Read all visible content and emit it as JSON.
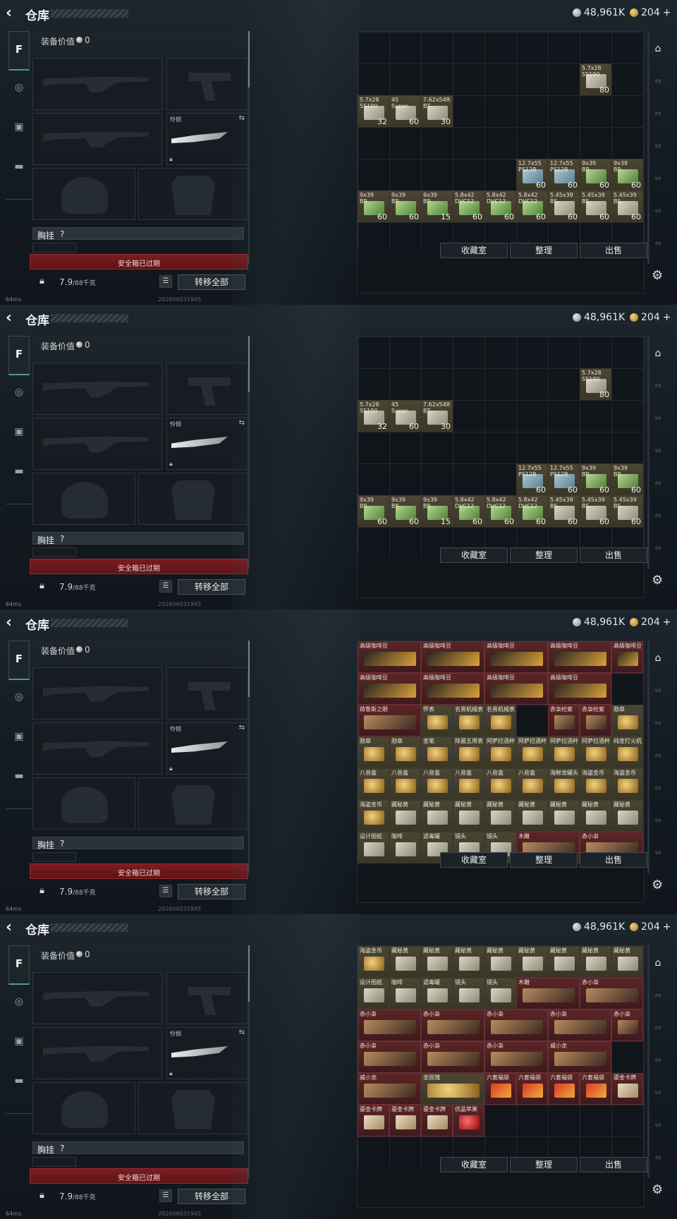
{
  "header": {
    "back_icon": "chevron-left-icon",
    "title": "仓库",
    "silver": "48,961K",
    "gold": "204",
    "plus": "+"
  },
  "left_nav": [
    "weapon-tab",
    "armor-tab",
    "backpack-tab",
    "case-tab"
  ],
  "equipment": {
    "value_label": "装备价值",
    "value": "0",
    "knife_label": "怜悯",
    "vest_label": "胸挂",
    "vest_q": "?",
    "safe_label": "安全箱已过期",
    "weight": "7.9",
    "weight_unit": "/88千克",
    "move_all": "转移全部"
  },
  "status": {
    "ping": "64ms",
    "build": "202606031945"
  },
  "bottom_buttons": {
    "collect": "收藏室",
    "sort": "整理",
    "sell": "出售"
  },
  "frames": [
    {
      "items": [
        {
          "l": "5.7x28\nSS190",
          "c": "80",
          "col": 7,
          "row": 1,
          "t": "ammo"
        },
        {
          "l": "5.7x28\nSS190",
          "c": "32",
          "col": 0,
          "row": 2,
          "t": "ammo"
        },
        {
          "l": "45\nSuper",
          "c": "60",
          "col": 1,
          "row": 2,
          "t": "ammo"
        },
        {
          "l": "7.62x54R\nBT",
          "c": "30",
          "col": 2,
          "row": 2,
          "t": "ammo"
        },
        {
          "l": "12.7x55\nPS12B",
          "c": "60",
          "col": 5,
          "row": 4,
          "t": "blue"
        },
        {
          "l": "12.7x55\nPS12B",
          "c": "60",
          "col": 6,
          "row": 4,
          "t": "blue"
        },
        {
          "l": "9x39\nBP",
          "c": "60",
          "col": 7,
          "row": 4,
          "t": "green"
        },
        {
          "l": "9x39\nBP",
          "c": "60",
          "col": 8,
          "row": 4,
          "t": "green"
        },
        {
          "l": "9x39\nBP",
          "c": "60",
          "col": 0,
          "row": 5,
          "t": "green"
        },
        {
          "l": "9x39\nBP",
          "c": "60",
          "col": 1,
          "row": 5,
          "t": "green"
        },
        {
          "l": "9x39\nBP",
          "c": "15",
          "col": 2,
          "row": 5,
          "t": "green"
        },
        {
          "l": "5.8x42\nDVC12",
          "c": "60",
          "col": 3,
          "row": 5,
          "t": "green"
        },
        {
          "l": "5.8x42\nDVC12",
          "c": "60",
          "col": 4,
          "row": 5,
          "t": "green"
        },
        {
          "l": "5.8x42\nDVC12",
          "c": "60",
          "col": 5,
          "row": 5,
          "t": "green"
        },
        {
          "l": "5.45x39\nBS",
          "c": "60",
          "col": 6,
          "row": 5,
          "t": "ammo"
        },
        {
          "l": "5.45x39\nBS",
          "c": "60",
          "col": 7,
          "row": 5,
          "t": "ammo"
        },
        {
          "l": "5.45x39\nBS",
          "c": "60",
          "col": 8,
          "row": 5,
          "t": "ammo"
        }
      ]
    },
    {
      "items": [
        {
          "l": "5.7x28\nSS190",
          "c": "80",
          "col": 7,
          "row": 1,
          "t": "ammo"
        },
        {
          "l": "5.7x28\nSS190",
          "c": "32",
          "col": 0,
          "row": 2,
          "t": "ammo"
        },
        {
          "l": "45\nSuper",
          "c": "60",
          "col": 1,
          "row": 2,
          "t": "ammo"
        },
        {
          "l": "7.62x54R\nBT",
          "c": "30",
          "col": 2,
          "row": 2,
          "t": "ammo"
        },
        {
          "l": "12.7x55\nPS12B",
          "c": "60",
          "col": 5,
          "row": 4,
          "t": "blue"
        },
        {
          "l": "12.7x55\nPS12B",
          "c": "60",
          "col": 6,
          "row": 4,
          "t": "blue"
        },
        {
          "l": "9x39\nBP",
          "c": "60",
          "col": 7,
          "row": 4,
          "t": "green"
        },
        {
          "l": "9x39\nBP",
          "c": "60",
          "col": 8,
          "row": 4,
          "t": "green"
        },
        {
          "l": "9x39\nBP",
          "c": "60",
          "col": 0,
          "row": 5,
          "t": "green"
        },
        {
          "l": "9x39\nBP",
          "c": "60",
          "col": 1,
          "row": 5,
          "t": "green"
        },
        {
          "l": "9x39\nBP",
          "c": "15",
          "col": 2,
          "row": 5,
          "t": "green"
        },
        {
          "l": "5.8x42\nDVC12",
          "c": "60",
          "col": 3,
          "row": 5,
          "t": "green"
        },
        {
          "l": "5.8x42\nDVC12",
          "c": "60",
          "col": 4,
          "row": 5,
          "t": "green"
        },
        {
          "l": "5.8x42\nDVC12",
          "c": "60",
          "col": 5,
          "row": 5,
          "t": "green"
        },
        {
          "l": "5.45x39\nBS",
          "c": "60",
          "col": 6,
          "row": 5,
          "t": "ammo"
        },
        {
          "l": "5.45x39\nBS",
          "c": "60",
          "col": 7,
          "row": 5,
          "t": "ammo"
        },
        {
          "l": "5.45x39\nBS",
          "c": "60",
          "col": 8,
          "row": 5,
          "t": "ammo"
        }
      ]
    },
    {
      "items": [
        {
          "l": "高级咖啡豆",
          "col": 0,
          "row": 0,
          "w": 2,
          "t": "coffee"
        },
        {
          "l": "高级咖啡豆",
          "col": 2,
          "row": 0,
          "w": 2,
          "t": "coffee"
        },
        {
          "l": "高级咖啡豆",
          "col": 4,
          "row": 0,
          "w": 2,
          "t": "coffee"
        },
        {
          "l": "高级咖啡豆",
          "col": 6,
          "row": 0,
          "w": 2,
          "t": "coffee"
        },
        {
          "l": "高级咖啡豆",
          "col": 8,
          "row": 0,
          "t": "coffee"
        },
        {
          "l": "高级咖啡豆",
          "col": 0,
          "row": 1,
          "w": 2,
          "t": "coffee"
        },
        {
          "l": "高级咖啡豆",
          "col": 2,
          "row": 1,
          "w": 2,
          "t": "coffee"
        },
        {
          "l": "高级咖啡豆",
          "col": 4,
          "row": 1,
          "w": 2,
          "t": "coffee"
        },
        {
          "l": "高级咖啡豆",
          "col": 6,
          "row": 1,
          "w": 2,
          "t": "coffee"
        },
        {
          "l": "荷鲁斯之眼",
          "col": 0,
          "row": 2,
          "w": 2,
          "t": "statue"
        },
        {
          "l": "怀表",
          "col": 2,
          "row": 2,
          "t": "gold"
        },
        {
          "l": "名贵机械表",
          "col": 3,
          "row": 2,
          "t": "gold"
        },
        {
          "l": "名贵机械表",
          "col": 4,
          "row": 2,
          "t": "gold"
        },
        {
          "l": "赤枭检索",
          "col": 6,
          "row": 2,
          "t": "statue"
        },
        {
          "l": "赤枭检索",
          "col": 7,
          "row": 2,
          "t": "statue"
        },
        {
          "l": "勋章",
          "col": 8,
          "row": 2,
          "t": "gold"
        },
        {
          "l": "勋章",
          "col": 0,
          "row": 3,
          "t": "gold"
        },
        {
          "l": "勋章",
          "col": 1,
          "row": 3,
          "t": "gold"
        },
        {
          "l": "金笔",
          "col": 2,
          "row": 3,
          "t": "gold"
        },
        {
          "l": "除菌五用表",
          "col": 3,
          "row": 3,
          "t": "gold"
        },
        {
          "l": "阿萨拉酒杯",
          "col": 4,
          "row": 3,
          "t": "gold"
        },
        {
          "l": "阿萨拉酒杯",
          "col": 5,
          "row": 3,
          "t": "gold"
        },
        {
          "l": "阿萨拉酒杯",
          "col": 6,
          "row": 3,
          "t": "gold"
        },
        {
          "l": "阿萨拉酒杯",
          "col": 7,
          "row": 3,
          "t": "gold"
        },
        {
          "l": "纯金打火机",
          "col": 8,
          "row": 3,
          "t": "gold"
        },
        {
          "l": "八音盒",
          "col": 0,
          "row": 4,
          "t": "gold"
        },
        {
          "l": "八音盒",
          "col": 1,
          "row": 4,
          "t": "gold"
        },
        {
          "l": "八音盒",
          "col": 2,
          "row": 4,
          "t": "gold"
        },
        {
          "l": "八音盒",
          "col": 3,
          "row": 4,
          "t": "gold"
        },
        {
          "l": "八音盒",
          "col": 4,
          "row": 4,
          "t": "gold"
        },
        {
          "l": "八音盒",
          "col": 5,
          "row": 4,
          "t": "gold"
        },
        {
          "l": "海鲜龙罐头",
          "col": 6,
          "row": 4,
          "t": "gold"
        },
        {
          "l": "海盗金币",
          "col": 7,
          "row": 4,
          "t": "gold"
        },
        {
          "l": "海盗金币",
          "col": 8,
          "row": 4,
          "t": "gold"
        },
        {
          "l": "海盗金币",
          "col": 0,
          "row": 5,
          "t": "gold"
        },
        {
          "l": "藏秘黄",
          "col": 1,
          "row": 5,
          "t": "ammo"
        },
        {
          "l": "藏秘黄",
          "col": 2,
          "row": 5,
          "t": "ammo"
        },
        {
          "l": "藏秘黄",
          "col": 3,
          "row": 5,
          "t": "ammo"
        },
        {
          "l": "藏秘黄",
          "col": 4,
          "row": 5,
          "t": "ammo"
        },
        {
          "l": "藏秘黄",
          "col": 5,
          "row": 5,
          "t": "ammo"
        },
        {
          "l": "藏秘黄",
          "col": 6,
          "row": 5,
          "t": "ammo"
        },
        {
          "l": "藏秘黄",
          "col": 7,
          "row": 5,
          "t": "ammo"
        },
        {
          "l": "藏秘黄",
          "col": 8,
          "row": 5,
          "t": "ammo"
        },
        {
          "l": "设计图纸",
          "col": 0,
          "row": 6,
          "t": "ammo"
        },
        {
          "l": "咖啡",
          "col": 1,
          "row": 6,
          "t": "ammo"
        },
        {
          "l": "滤毒罐",
          "col": 2,
          "row": 6,
          "t": "ammo"
        },
        {
          "l": "镜头",
          "col": 3,
          "row": 6,
          "t": "ammo"
        },
        {
          "l": "镜头",
          "col": 4,
          "row": 6,
          "t": "ammo"
        },
        {
          "l": "木雕",
          "col": 5,
          "row": 6,
          "w": 2,
          "t": "statue"
        },
        {
          "l": "赤小枭",
          "col": 7,
          "row": 6,
          "w": 2,
          "t": "statue"
        }
      ]
    },
    {
      "items": [
        {
          "l": "海盗金币",
          "col": 0,
          "row": 0,
          "t": "gold"
        },
        {
          "l": "藏秘黄",
          "col": 1,
          "row": 0,
          "t": "ammo"
        },
        {
          "l": "藏秘黄",
          "col": 2,
          "row": 0,
          "t": "ammo"
        },
        {
          "l": "藏秘黄",
          "col": 3,
          "row": 0,
          "t": "ammo"
        },
        {
          "l": "藏秘黄",
          "col": 4,
          "row": 0,
          "t": "ammo"
        },
        {
          "l": "藏秘黄",
          "col": 5,
          "row": 0,
          "t": "ammo"
        },
        {
          "l": "藏秘黄",
          "col": 6,
          "row": 0,
          "t": "ammo"
        },
        {
          "l": "藏秘黄",
          "col": 7,
          "row": 0,
          "t": "ammo"
        },
        {
          "l": "藏秘黄",
          "col": 8,
          "row": 0,
          "t": "ammo"
        },
        {
          "l": "设计图纸",
          "col": 0,
          "row": 1,
          "t": "ammo"
        },
        {
          "l": "咖啡",
          "col": 1,
          "row": 1,
          "t": "ammo"
        },
        {
          "l": "滤毒罐",
          "col": 2,
          "row": 1,
          "t": "ammo"
        },
        {
          "l": "镜头",
          "col": 3,
          "row": 1,
          "t": "ammo"
        },
        {
          "l": "镜头",
          "col": 4,
          "row": 1,
          "t": "ammo"
        },
        {
          "l": "木雕",
          "col": 5,
          "row": 1,
          "w": 2,
          "t": "statue"
        },
        {
          "l": "赤小枭",
          "col": 7,
          "row": 1,
          "w": 2,
          "t": "statue"
        },
        {
          "l": "赤小枭",
          "col": 0,
          "row": 2,
          "w": 2,
          "t": "statue"
        },
        {
          "l": "赤小枭",
          "col": 2,
          "row": 2,
          "w": 2,
          "t": "statue"
        },
        {
          "l": "赤小枭",
          "col": 4,
          "row": 2,
          "w": 2,
          "t": "statue"
        },
        {
          "l": "赤小枭",
          "col": 6,
          "row": 2,
          "w": 2,
          "t": "statue"
        },
        {
          "l": "赤小枭",
          "col": 8,
          "row": 2,
          "t": "statue"
        },
        {
          "l": "赤小枭",
          "col": 0,
          "row": 3,
          "w": 2,
          "t": "statue"
        },
        {
          "l": "赤小枭",
          "col": 2,
          "row": 3,
          "w": 2,
          "t": "statue"
        },
        {
          "l": "赤小枭",
          "col": 4,
          "row": 3,
          "w": 2,
          "t": "statue"
        },
        {
          "l": "威小龙",
          "col": 6,
          "row": 3,
          "w": 2,
          "t": "statue"
        },
        {
          "l": "威小龙",
          "col": 0,
          "row": 4,
          "w": 2,
          "t": "statue"
        },
        {
          "l": "金玫瑰",
          "col": 2,
          "row": 4,
          "w": 2,
          "t": "gold"
        },
        {
          "l": "六套福袋",
          "col": 4,
          "row": 4,
          "t": "red"
        },
        {
          "l": "六套福袋",
          "col": 5,
          "row": 4,
          "t": "red"
        },
        {
          "l": "六套福袋",
          "col": 6,
          "row": 4,
          "t": "red"
        },
        {
          "l": "六套福袋",
          "col": 7,
          "row": 4,
          "t": "red"
        },
        {
          "l": "鎏金卡牌",
          "col": 8,
          "row": 4,
          "t": "card"
        },
        {
          "l": "鎏金卡牌",
          "col": 0,
          "row": 5,
          "t": "card"
        },
        {
          "l": "鎏金卡牌",
          "col": 1,
          "row": 5,
          "t": "card"
        },
        {
          "l": "鎏金卡牌",
          "col": 2,
          "row": 5,
          "t": "card"
        },
        {
          "l": "优品苹果",
          "col": 3,
          "row": 5,
          "t": "apple"
        }
      ]
    }
  ]
}
